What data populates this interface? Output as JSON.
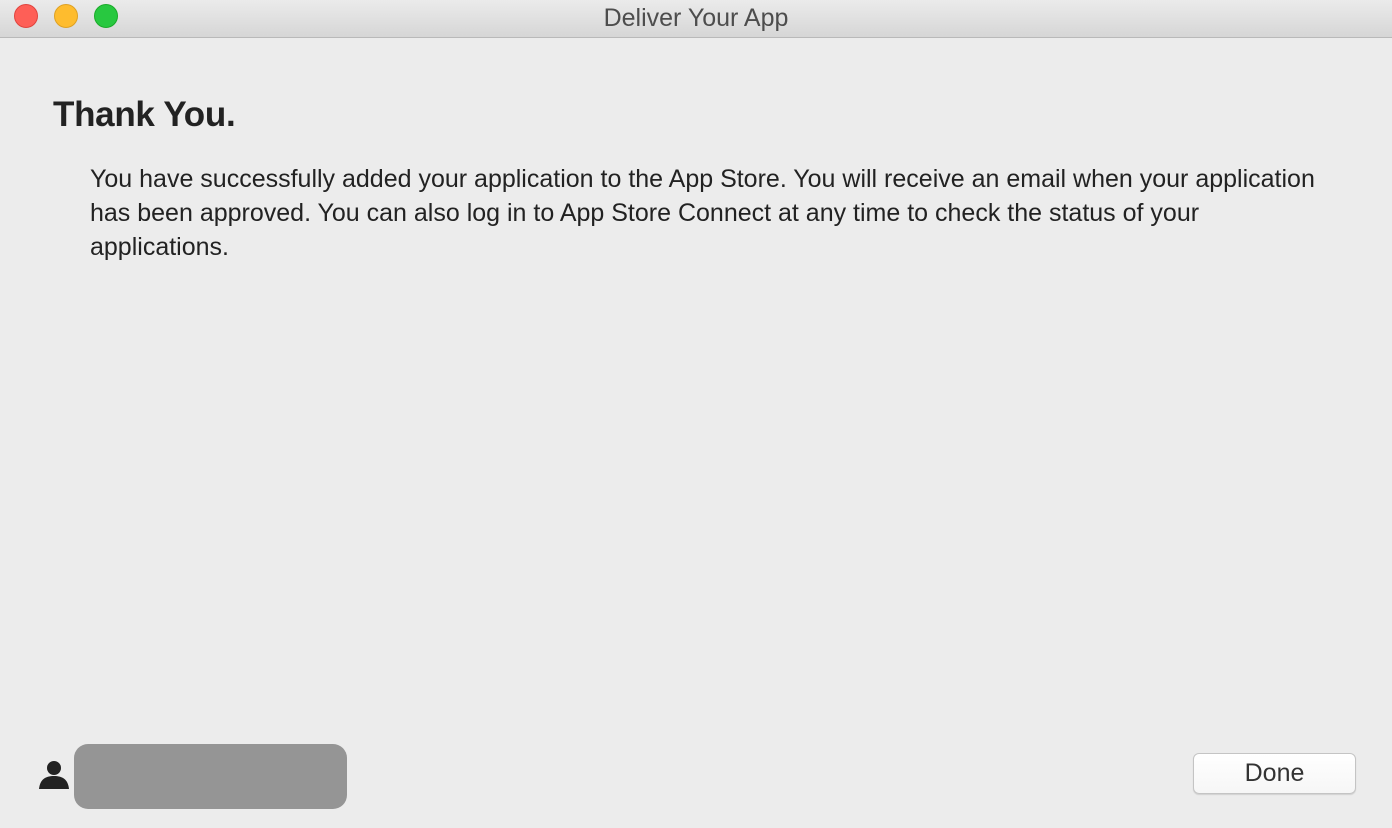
{
  "window": {
    "title": "Deliver Your App",
    "controls": {
      "close_color": "#fe5f57",
      "minimize_color": "#febc2e",
      "zoom_color": "#28c840"
    }
  },
  "content": {
    "heading": "Thank You.",
    "message": "You have successfully added your application to the App Store. You will receive an email when your application has been approved. You can also log in to App Store Connect at any time to check the status of your applications."
  },
  "footer": {
    "account_icon": "user-silhouette-icon",
    "done_label": "Done"
  }
}
